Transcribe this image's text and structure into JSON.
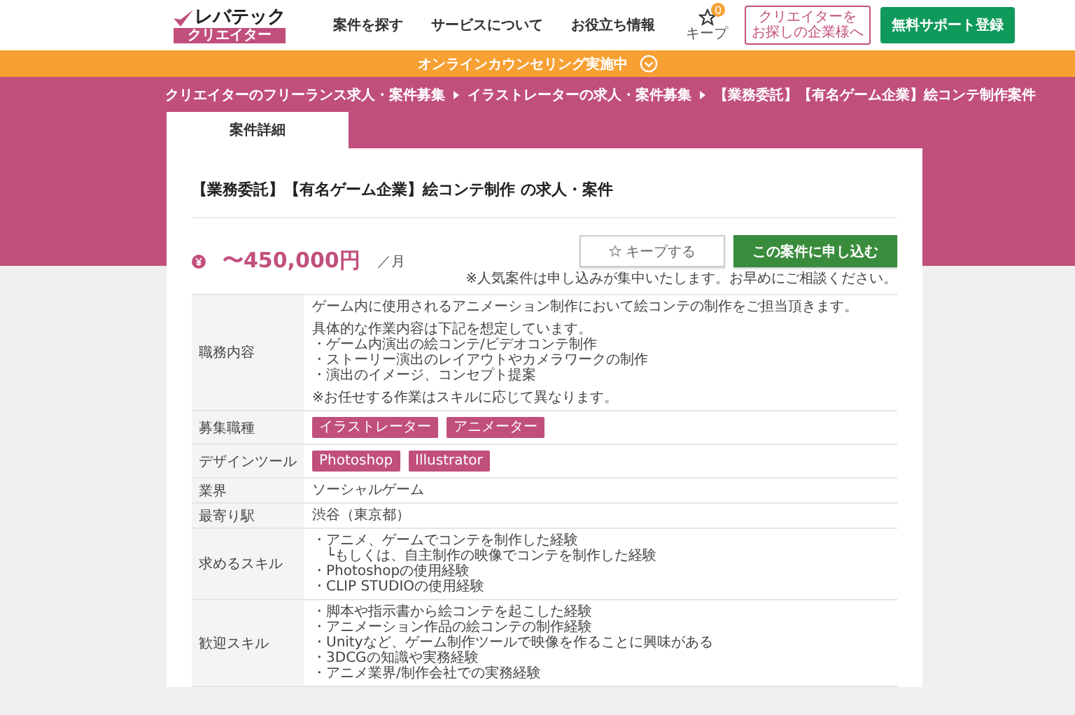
{
  "header": {
    "logo": {
      "main": "レバテック",
      "sub": "クリエイター"
    },
    "nav": [
      "案件を探す",
      "サービスについて",
      "お役立ち情報"
    ],
    "keep": {
      "label": "キープ",
      "count": "0"
    },
    "company_button": [
      "クリエイターを",
      "お探しの企業様へ"
    ],
    "register_button": "無料サポート登録"
  },
  "banner": {
    "text": "オンラインカウンセリング実施中"
  },
  "breadcrumbs": [
    "クリエイターのフリーランス求人・案件募集",
    "イラストレーターの求人・案件募集",
    "【業務委託】【有名ゲーム企業】絵コンテ制作案件"
  ],
  "tabs": [
    {
      "label": "案件詳細",
      "selected": true
    }
  ],
  "job": {
    "title": "【業務委託】【有名ゲーム企業】絵コンテ制作 の求人・案件",
    "salary": "〜450,000円",
    "salary_unit": "／月",
    "keep_button": "キープする",
    "apply_button": "この案件に申し込む",
    "note": "※人気案件は申し込みが集中いたします。お早めにご相談ください。"
  },
  "details": [
    {
      "label": "職務内容",
      "kind": "paragraphs",
      "paragraphs": [
        [
          "ゲーム内に使用されるアニメーション制作において絵コンテの制作をご担当頂きます。"
        ],
        [
          "具体的な作業内容は下記を想定しています。",
          "・ゲーム内演出の絵コンテ/ビデオコンテ制作",
          "・ストーリー演出のレイアウトやカメラワークの制作",
          "・演出のイメージ、コンセプト提案"
        ],
        [
          "※お任せする作業はスキルに応じて異なります。"
        ]
      ]
    },
    {
      "label": "募集職種",
      "kind": "tags",
      "tags": [
        "イラストレーター",
        "アニメーター"
      ]
    },
    {
      "label": "デザインツール",
      "kind": "tags",
      "tags": [
        "Photoshop",
        "Illustrator"
      ]
    },
    {
      "label": "業界",
      "kind": "text",
      "text": "ソーシャルゲーム"
    },
    {
      "label": "最寄り駅",
      "kind": "text",
      "text": "渋谷（東京都）"
    },
    {
      "label": "求めるスキル",
      "kind": "list",
      "items": [
        {
          "text": "・アニメ、ゲームでコンテを制作した経験",
          "children": [
            {
              "text": "└もしくは、自主制作の映像でコンテを制作した経験"
            }
          ]
        },
        {
          "text": "・Photoshopの使用経験"
        },
        {
          "text": "・CLIP STUDIOの使用経験"
        }
      ]
    },
    {
      "label": "歓迎スキル",
      "kind": "list",
      "items": [
        {
          "text": "・脚本や指示書から絵コンテを起こした経験"
        },
        {
          "text": "・アニメーション作品の絵コンテの制作経験"
        },
        {
          "text": "・Unityなど、ゲーム制作ツールで映像を作ることに興味がある"
        },
        {
          "text": "・3DCGの知識や実務経験"
        },
        {
          "text": "・アニメ業界/制作会社での実務経験"
        }
      ]
    }
  ]
}
